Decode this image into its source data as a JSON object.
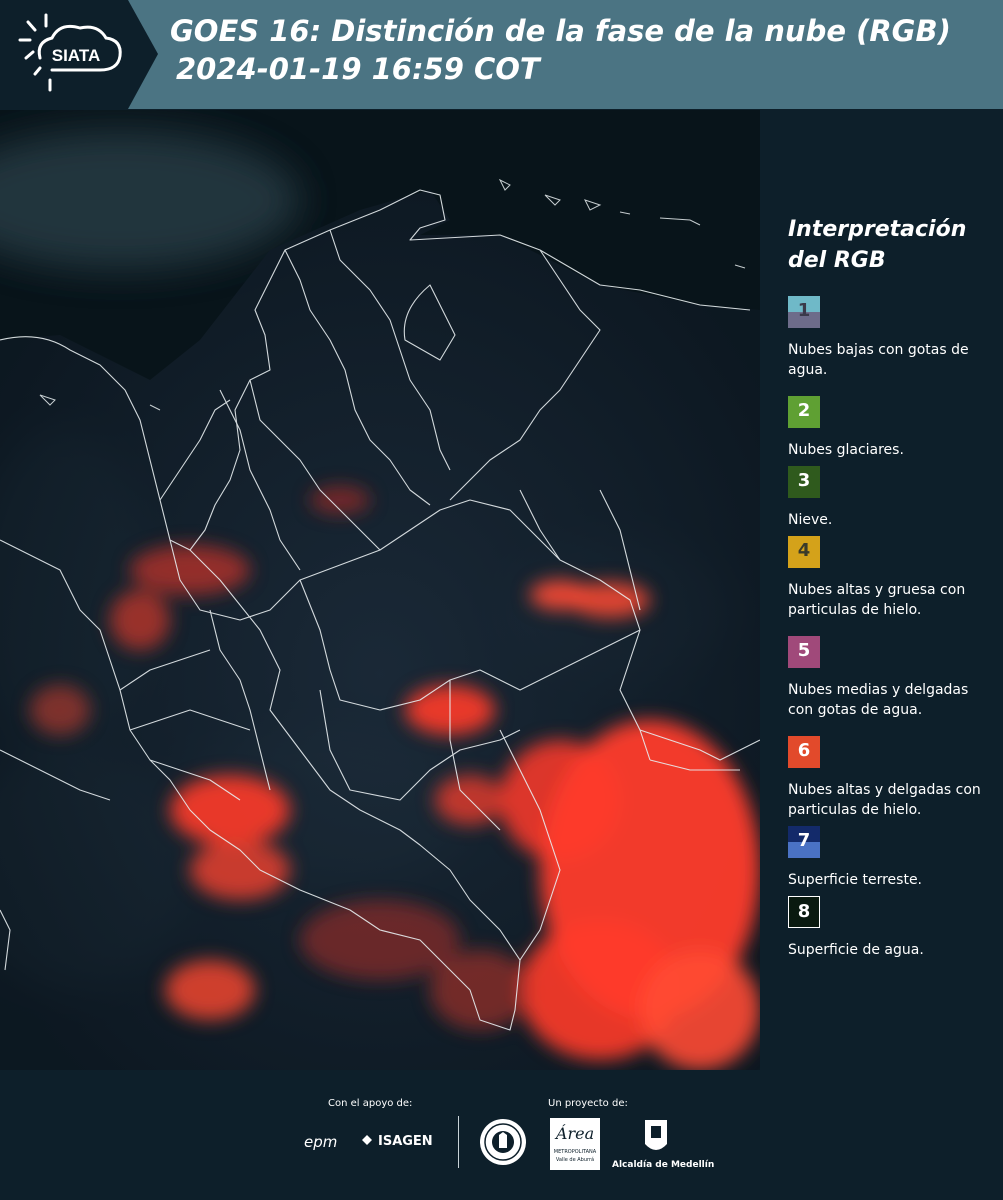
{
  "header": {
    "logo_text": "SIATA",
    "title_line1": "GOES 16: Distinción de la fase de la nube (RGB)",
    "title_line2": "2024-01-19 16:59 COT"
  },
  "legend": {
    "title_line1": "Interpretación",
    "title_line2": "del RGB",
    "items": [
      {
        "number": "1",
        "label": "Nubes bajas con gotas de agua.",
        "color_top": "#6fb9c8",
        "color_bottom": "#6d6c8a",
        "text_color": "#3a3a4a"
      },
      {
        "number": "2",
        "label": "Nubes glaciares.",
        "color_top": "#5fa033",
        "color_bottom": "#5fa033",
        "text_color": "#ffffff"
      },
      {
        "number": "3",
        "label": "Nieve.",
        "color_top": "#2f5a1d",
        "color_bottom": "#2f5a1d",
        "text_color": "#ffffff"
      },
      {
        "number": "4",
        "label": "Nubes altas y gruesa con particulas de hielo.",
        "color_top": "#d4a21a",
        "color_bottom": "#d4a21a",
        "text_color": "#3a3a2a"
      },
      {
        "number": "5",
        "label": "Nubes medias y delgadas con gotas de agua.",
        "color_top": "#a0497a",
        "color_bottom": "#a0497a",
        "text_color": "#ffffff"
      },
      {
        "number": "6",
        "label": "Nubes altas y delgadas con particulas de hielo.",
        "color_top": "#e24a2b",
        "color_bottom": "#e24a2b",
        "text_color": "#ffffff"
      },
      {
        "number": "7",
        "label": "Superficie terreste.",
        "color_top": "#132a6a",
        "color_bottom": "#4a72c4",
        "text_color": "#ffffff"
      },
      {
        "number": "8",
        "label": "Superficie de agua.",
        "color_top": "#0a1a10",
        "color_bottom": "#0a1a10",
        "text_color": "#ffffff"
      }
    ]
  },
  "footer": {
    "support_label": "Con el apoyo de:",
    "project_label": "Un proyecto de:",
    "sponsor1": "epm",
    "sponsor2": "ISAGEN",
    "area_text": "Área",
    "area_sub1": "METROPOLITANA",
    "area_sub2": "Valle de Aburrá",
    "alcaldia": "Alcaldía de Medellín"
  }
}
